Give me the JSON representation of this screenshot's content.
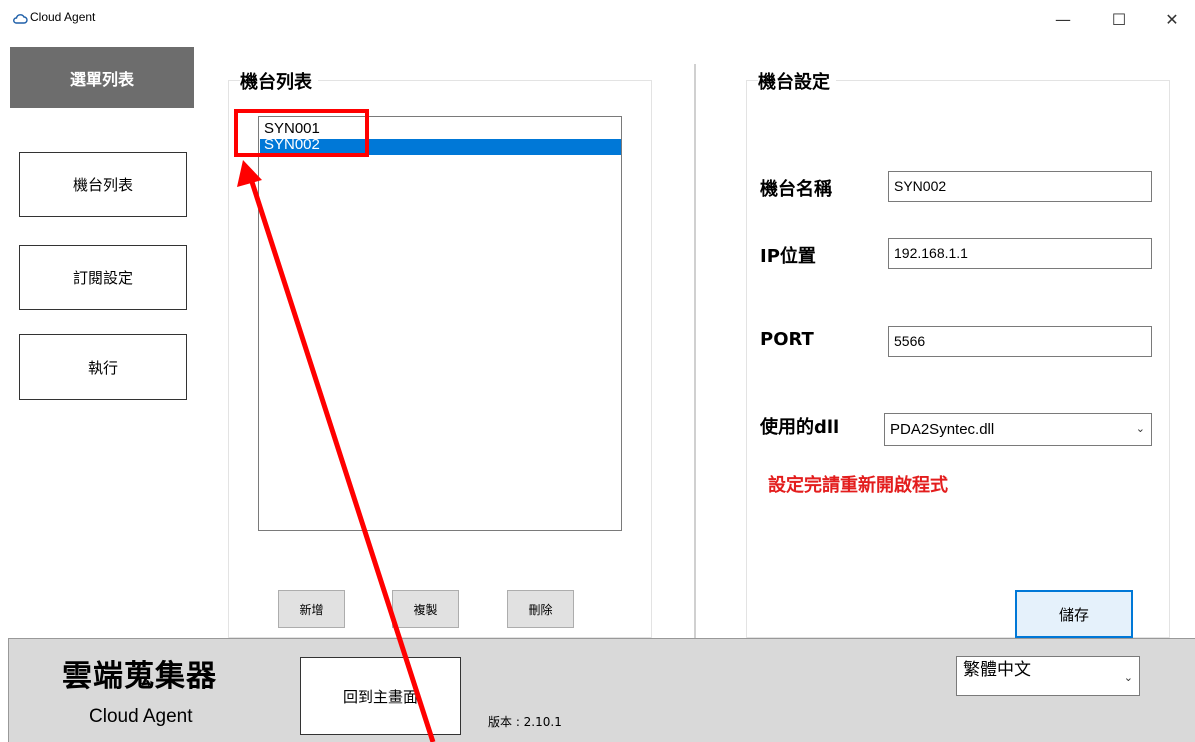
{
  "window": {
    "title": "Cloud Agent",
    "minimize_glyph": "—",
    "maximize_glyph": "☐",
    "close_glyph": "✕"
  },
  "sidebar": {
    "header": "選單列表",
    "items": [
      {
        "label": "機台列表"
      },
      {
        "label": "訂閱設定"
      },
      {
        "label": "執行"
      }
    ]
  },
  "machine_list": {
    "title": "機台列表",
    "items": [
      "SYN001",
      "SYN002"
    ],
    "selected_index": 1,
    "buttons": {
      "add": "新增",
      "copy": "複製",
      "delete": "刪除"
    }
  },
  "settings": {
    "title": "機台設定",
    "name_label": "機台名稱",
    "name_value": "SYN002",
    "ip_label": "IP位置",
    "ip_value": "192.168.1.1",
    "port_label": "PORT",
    "port_value": "5566",
    "dll_label": "使用的dll",
    "dll_value": "PDA2Syntec.dll",
    "warning": "設定完請重新開啟程式",
    "save_label": "儲存"
  },
  "footer": {
    "brand_zh": "雲端蒐集器",
    "brand_en": "Cloud Agent",
    "home_label": "回到主畫面",
    "version": "版本 : 2.10.1",
    "language": "繁體中文"
  },
  "colors": {
    "accent": "#0078d7",
    "warning": "#e31d1d",
    "annotation": "#ff0000",
    "menu_header_bg": "#6d6d6d"
  },
  "icons": {
    "app": "cloud-icon",
    "dropdown": "chevron-down-icon"
  }
}
